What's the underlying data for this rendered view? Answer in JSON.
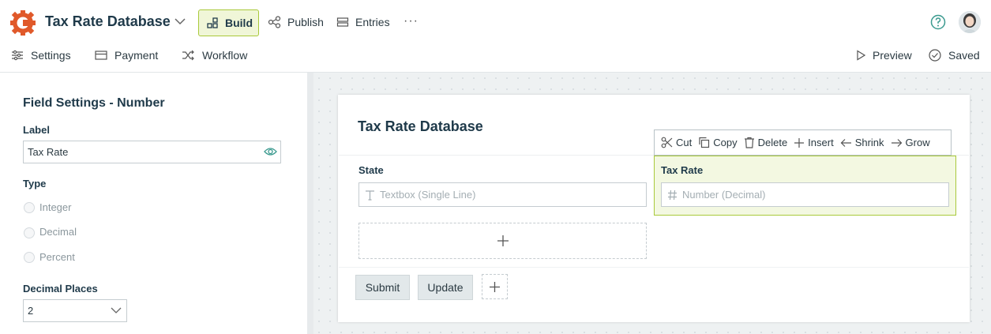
{
  "app": {
    "title": "Tax Rate Database"
  },
  "topnav": {
    "build": "Build",
    "publish": "Publish",
    "entries": "Entries",
    "more": "···"
  },
  "subnav": {
    "settings": "Settings",
    "payment": "Payment",
    "workflow": "Workflow",
    "preview": "Preview",
    "saved": "Saved"
  },
  "panel": {
    "title": "Field Settings - Number",
    "label_heading": "Label",
    "label_value": "Tax Rate",
    "type_heading": "Type",
    "types": [
      "Integer",
      "Decimal",
      "Percent"
    ],
    "decimal_heading": "Decimal Places",
    "decimal_value": "2"
  },
  "form": {
    "title": "Tax Rate Database",
    "state_label": "State",
    "state_placeholder": "Textbox (Single Line)",
    "taxrate_label": "Tax Rate",
    "taxrate_placeholder": "Number (Decimal)",
    "submit": "Submit",
    "update": "Update"
  },
  "toolbar": {
    "cut": "Cut",
    "copy": "Copy",
    "delete": "Delete",
    "insert": "Insert",
    "shrink": "Shrink",
    "grow": "Grow"
  },
  "colors": {
    "brand": "#e0592a",
    "accent_border": "#a9c93a",
    "accent_bg": "#f3f8e1",
    "teal": "#3b9a8f"
  }
}
